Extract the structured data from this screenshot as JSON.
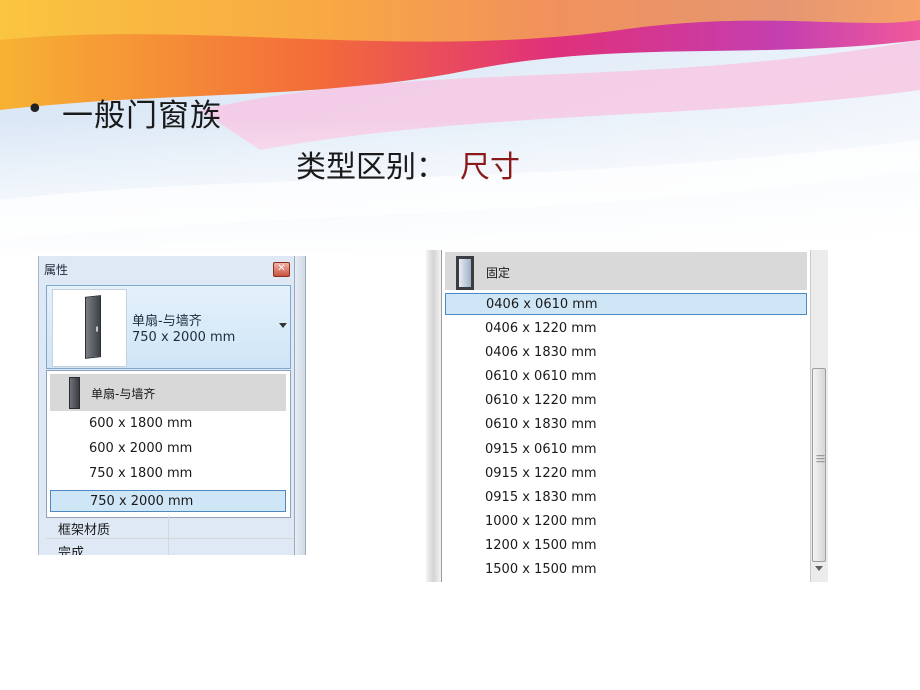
{
  "slide": {
    "bullet": "•",
    "heading": "一般门窗族",
    "subheading": "类型区别：",
    "subheading_accent": "尺寸"
  },
  "properties_panel": {
    "title": "属性",
    "close_glyph": "✕",
    "selected_type": {
      "name": "单扇-与墙齐",
      "size": "750 x 2000 mm"
    },
    "family": "单扇-与墙齐",
    "sizes": [
      "600 x 1800 mm",
      "600 x 2000 mm",
      "750 x 1800 mm",
      "750 x 2000 mm"
    ],
    "selected_size": "750 x 2000 mm",
    "rows": [
      {
        "label": "框架材质"
      },
      {
        "label": "完成"
      }
    ]
  },
  "size_list_panel": {
    "family": "固定",
    "options": [
      "0406 x 0610 mm",
      "0406 x 1220 mm",
      "0406 x 1830 mm",
      "0610 x 0610 mm",
      "0610 x 1220 mm",
      "0610 x 1830 mm",
      "0915 x 0610 mm",
      "0915 x 1220 mm",
      "0915 x 1830 mm",
      "1000 x 1200 mm",
      "1200 x 1500 mm",
      "1500 x 1500 mm"
    ],
    "selected_option": "0406 x 0610 mm"
  },
  "icons": [
    "door-icon",
    "window-icon",
    "close-icon",
    "dropdown-arrow-icon",
    "scroll-down-icon",
    "scroll-grip-icon"
  ],
  "colors": {
    "accent_text": "#8b1a1a",
    "selection_fill": "#cfe6f7",
    "selection_border": "#4d8ac4"
  }
}
